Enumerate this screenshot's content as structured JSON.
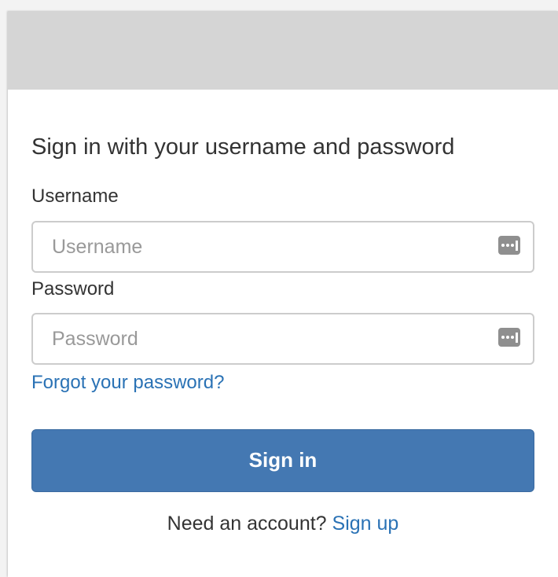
{
  "form": {
    "heading": "Sign in with your username and password",
    "username": {
      "label": "Username",
      "placeholder": "Username",
      "value": ""
    },
    "password": {
      "label": "Password",
      "placeholder": "Password",
      "value": ""
    },
    "forgot_link": "Forgot your password?",
    "submit_label": "Sign in",
    "signup_prompt": "Need an account?",
    "signup_link": "Sign up"
  },
  "icons": {
    "field_autofill": "password-manager-key-icon"
  },
  "colors": {
    "banner": "#d5d5d5",
    "button": "#4478b2",
    "link": "#2a72b5",
    "text": "#333333"
  }
}
